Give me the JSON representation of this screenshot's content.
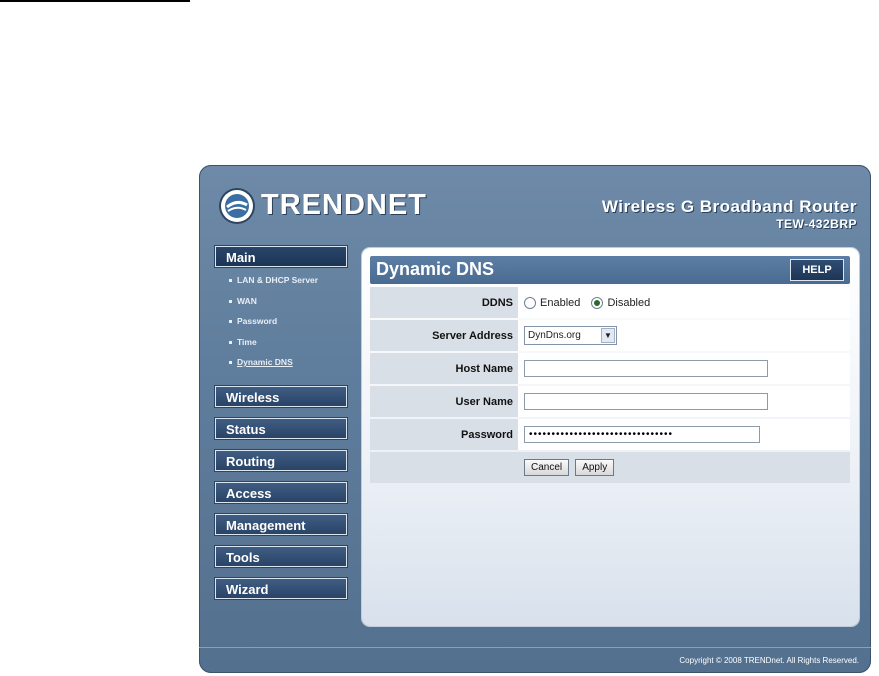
{
  "brand": {
    "name": "TRENDNET",
    "product_line": "Wireless G Broadband Router",
    "model": "TEW-432BRP"
  },
  "nav": {
    "main_label": "Main",
    "sub_items": [
      "LAN & DHCP Server",
      "WAN",
      "Password",
      "Time",
      "Dynamic DNS"
    ],
    "sections": [
      "Wireless",
      "Status",
      "Routing",
      "Access",
      "Management",
      "Tools",
      "Wizard"
    ]
  },
  "page": {
    "title": "Dynamic DNS",
    "help_label": "HELP"
  },
  "form": {
    "ddns_label": "DDNS",
    "ddns_options": [
      "Enabled",
      "Disabled"
    ],
    "ddns_selected": "Disabled",
    "server_label": "Server Address",
    "server_value": "DynDns.org",
    "host_label": "Host Name",
    "host_value": "",
    "user_label": "User Name",
    "user_value": "",
    "password_label": "Password",
    "password_value": "••••••••••••••••••••••••••••••••",
    "cancel_label": "Cancel",
    "apply_label": "Apply"
  },
  "footer": {
    "copyright": "Copyright © 2008 TRENDnet. All Rights Reserved."
  },
  "colors": {
    "frame": "#5f7d9c",
    "nav_button": "#2a4467",
    "title_bar": "#5c7ea5"
  }
}
